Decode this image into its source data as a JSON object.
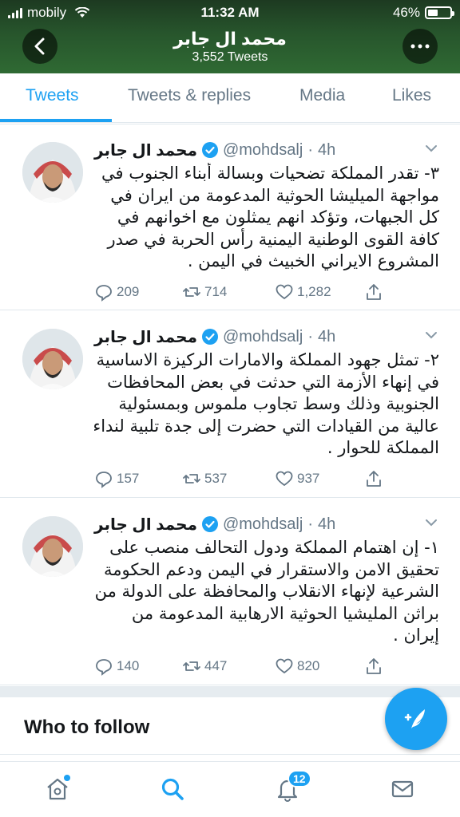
{
  "status_bar": {
    "carrier": "mobily",
    "time": "11:32 AM",
    "battery": "46%",
    "battery_level": 0.46
  },
  "header": {
    "profile_name": "محمد ال جابر",
    "tweet_count": "3,552 Tweets",
    "back_icon": "chevron-left-icon",
    "more_icon": "more-icon"
  },
  "tabs": [
    {
      "label": "Tweets",
      "active": true
    },
    {
      "label": "Tweets & replies",
      "active": false
    },
    {
      "label": "Media",
      "active": false
    },
    {
      "label": "Likes",
      "active": false
    }
  ],
  "tweets": [
    {
      "name": "محمد ال جابر",
      "handle": "@mohdsalj",
      "dot": "·",
      "time": "4h",
      "text": "٣- تقدر المملكة تضحيات وبسالة أبناء الجنوب في مواجهة الميليشا الحوثية المدعومة من ايران في كل الجبهات، وتؤكد انهم يمثلون مع اخوانهم في كافة القوى الوطنية اليمنية رأس الحربة في صدر المشروع الايراني الخبيث في اليمن .",
      "replies": "209",
      "retweets": "714",
      "likes": "1,282"
    },
    {
      "name": "محمد ال جابر",
      "handle": "@mohdsalj",
      "dot": "·",
      "time": "4h",
      "text": "٢- تمثل جهود المملكة والامارات الركيزة الاساسية في إنهاء الأزمة التي حدثت في بعض المحافظات الجنوبية وذلك وسط تجاوب ملموس وبمسئولية عالية من القيادات التي حضرت إلى جدة تلبية لنداء المملكة للحوار .",
      "replies": "157",
      "retweets": "537",
      "likes": "937"
    },
    {
      "name": "محمد ال جابر",
      "handle": "@mohdsalj",
      "dot": "·",
      "time": "4h",
      "text": "١- إن اهتمام المملكة ودول التحالف منصب على تحقيق الامن والاستقرار في اليمن ودعم الحكومة الشرعية لإنهاء الانقلاب والمحافظة على الدولة من براثن المليشيا الحوثية الارهابية المدعومة من إيران .",
      "replies": "140",
      "retweets": "447",
      "likes": "820"
    }
  ],
  "who_to_follow": {
    "title": "Who to follow"
  },
  "bottom_nav": {
    "notifications_badge": "12"
  },
  "colors": {
    "accent": "#1da1f2",
    "header_green": "#2f6a33",
    "secondary_text": "#657786"
  }
}
